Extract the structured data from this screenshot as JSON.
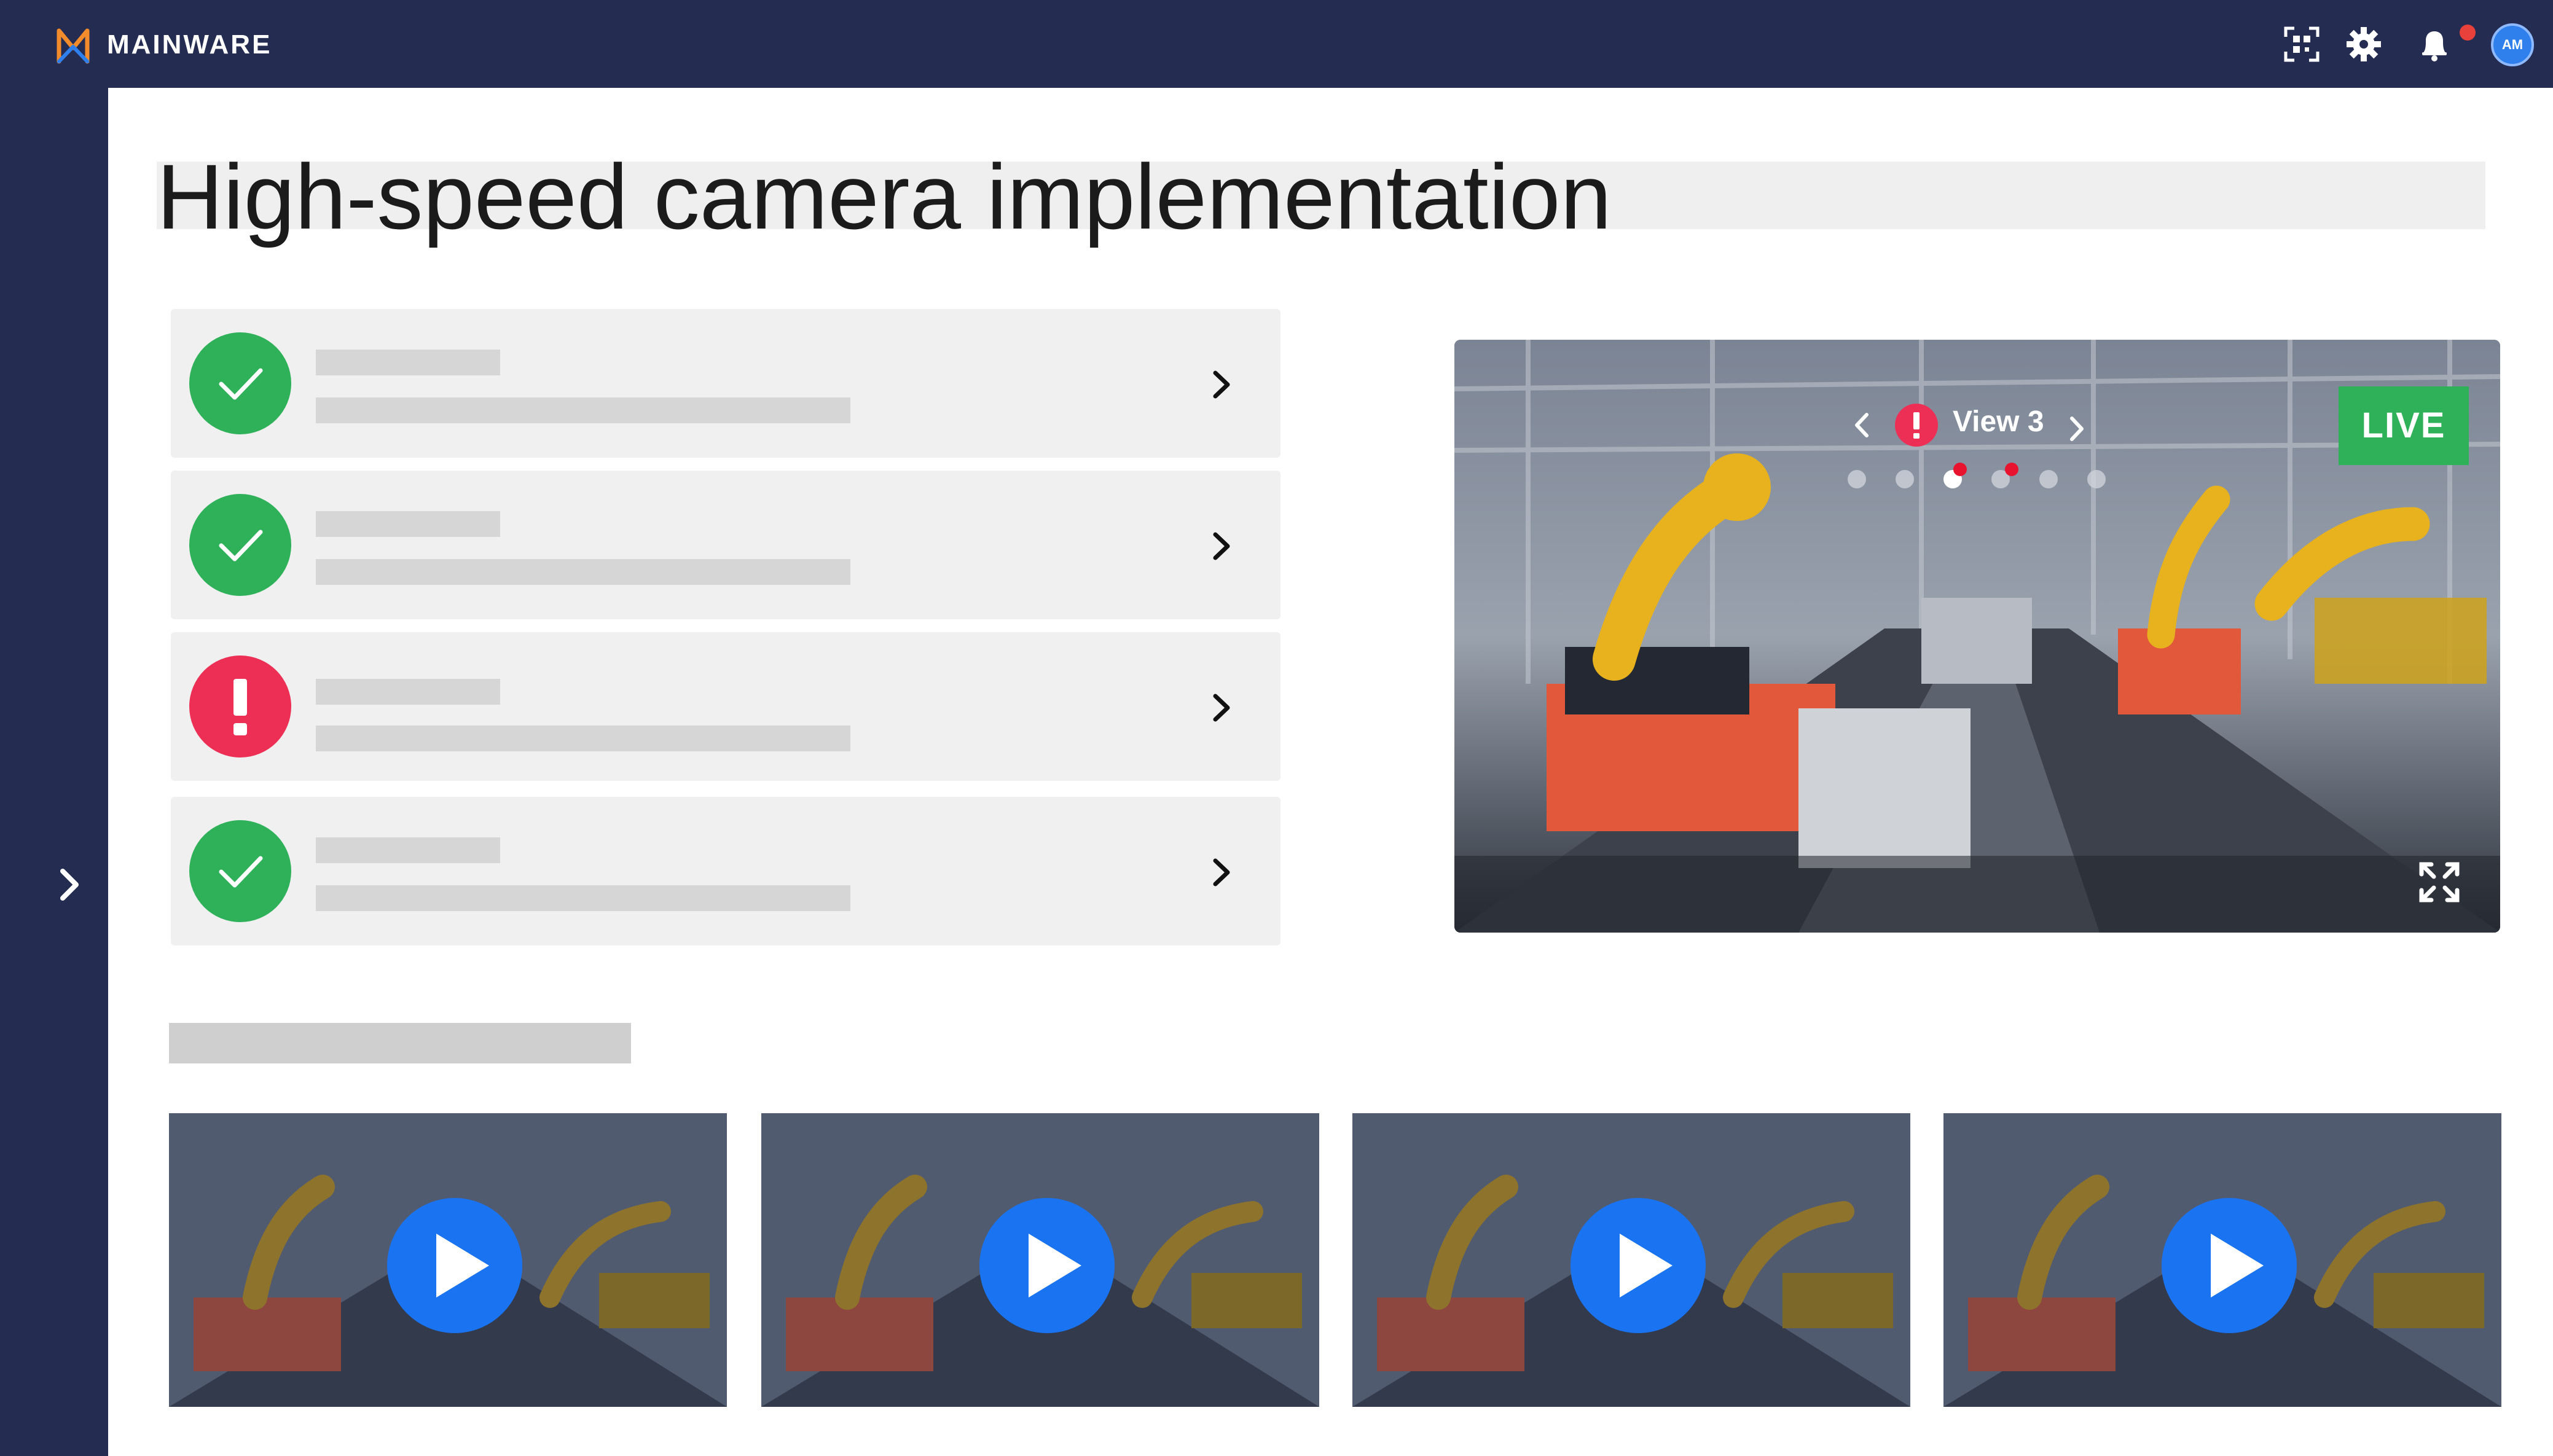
{
  "app": {
    "brand_name": "MAINWARE",
    "brand_color": "#f28b2b",
    "topbar_icons": [
      "qr-scan-icon",
      "gear-icon",
      "bell-icon"
    ],
    "notification_badge": "",
    "avatar_initials": "AM"
  },
  "page": {
    "title": "High-speed camera implementation"
  },
  "checklist": {
    "items": [
      {
        "status": "ok",
        "icon": "check-icon"
      },
      {
        "status": "ok",
        "icon": "check-icon"
      },
      {
        "status": "error",
        "icon": "exclamation-icon"
      },
      {
        "status": "ok",
        "icon": "check-icon"
      }
    ],
    "colors": {
      "ok": "#2fb15a",
      "error": "#ed2f55"
    }
  },
  "live_view": {
    "badge": "LIVE",
    "view_label": "View 3",
    "view_count": 6,
    "active_view_index": 2,
    "alert_views": [
      2,
      3
    ]
  },
  "recordings": {
    "count": 4,
    "play_color": "#1a73f0"
  }
}
